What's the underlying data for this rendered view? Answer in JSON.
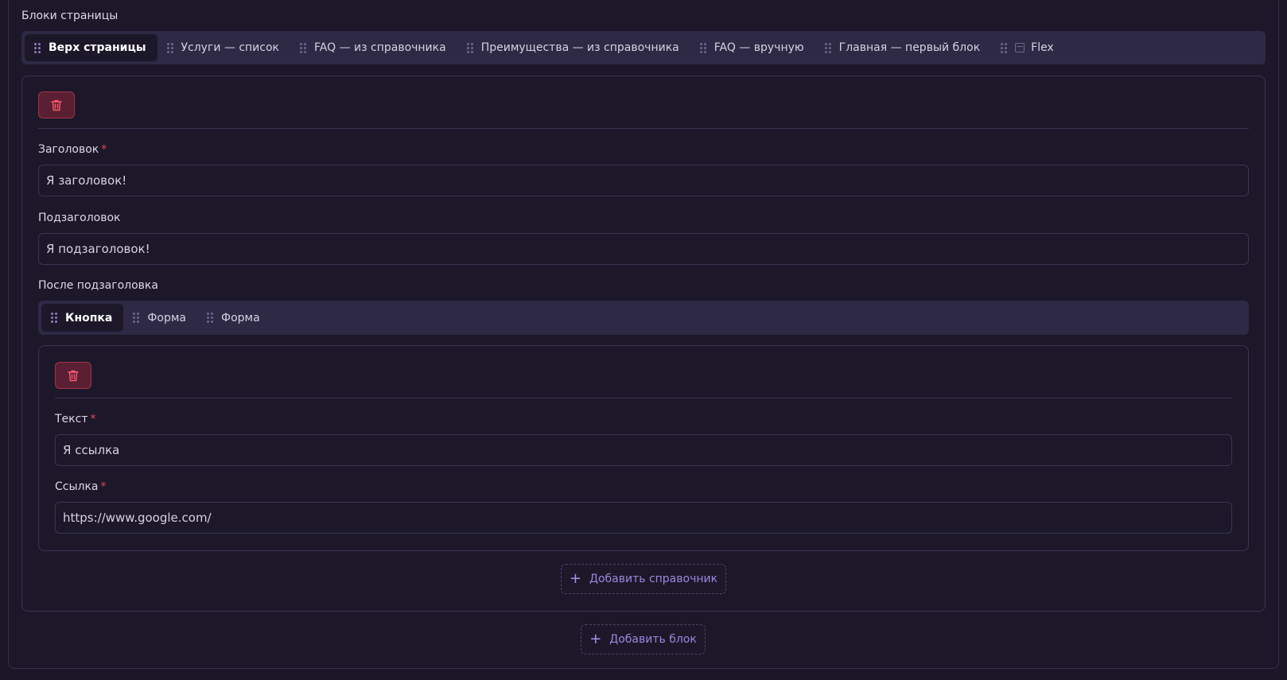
{
  "page": {
    "blocks_label": "Блоки страницы",
    "block_tabs": [
      {
        "label": "Верх страницы",
        "icon": "grip-icon"
      },
      {
        "label": "Услуги — список",
        "icon": "grip-icon"
      },
      {
        "label": "FAQ — из справочника",
        "icon": "grip-icon"
      },
      {
        "label": "Преимущества — из справочника",
        "icon": "grip-icon"
      },
      {
        "label": "FAQ — вручную",
        "icon": "grip-icon"
      },
      {
        "label": "Главная — первый блок",
        "icon": "grip-icon"
      },
      {
        "label": "Flex",
        "icon": "archive-icon"
      }
    ],
    "active_block_tab": "Верх страницы",
    "fields": {
      "title_label": "Заголовок",
      "title_value": "Я заголовок!",
      "subtitle_label": "Подзаголовок",
      "subtitle_value": "Я подзаголовок!",
      "after_subtitle_label": "После подзаголовка",
      "required_mark": "*"
    },
    "nested_tabs": [
      {
        "label": "Кнопка"
      },
      {
        "label": "Форма"
      },
      {
        "label": "Форма"
      }
    ],
    "active_nested_tab": "Кнопка",
    "nested_fields": {
      "text_label": "Текст",
      "text_value": "Я ссылка",
      "link_label": "Ссылка",
      "link_value": "https://www.google.com/"
    },
    "add_reference_label": "Добавить справочник",
    "add_block_label": "Добавить блок",
    "colors": {
      "background": "#1b1728",
      "tabbar": "#2e2944",
      "delete": "#a33247",
      "accent": "#9c86e0",
      "required": "#e0445a"
    }
  }
}
